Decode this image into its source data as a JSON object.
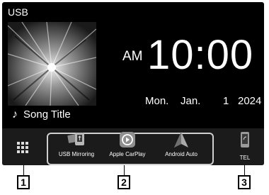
{
  "source": "USB",
  "song": {
    "title": "Song Title"
  },
  "clock": {
    "ampm": "AM",
    "time": "10:00"
  },
  "date": {
    "day_of_week": "Mon.",
    "month": "Jan.",
    "day": "1",
    "year": "2024"
  },
  "shortcuts": [
    {
      "label": "USB Mirroring",
      "icon": "usb-mirroring-icon"
    },
    {
      "label": "Apple CarPlay",
      "icon": "carplay-icon"
    },
    {
      "label": "Android Auto",
      "icon": "android-auto-icon"
    }
  ],
  "tel": {
    "label": "TEL",
    "icon": "phone-icon"
  },
  "menu": {
    "icon": "grid-menu-icon"
  },
  "callouts": [
    "1",
    "2",
    "3"
  ]
}
